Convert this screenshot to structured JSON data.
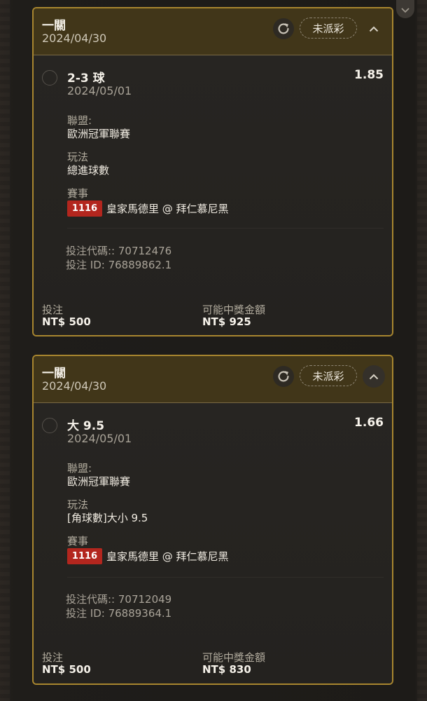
{
  "cards": [
    {
      "header": {
        "title": "一關",
        "date": "2024/04/30",
        "status_label": "未派彩"
      },
      "bet": {
        "selection": "2-3 球",
        "odds": "1.85",
        "date": "2024/05/01",
        "league_label": "聯盟:",
        "league_value": "歐洲冠軍聯賽",
        "play_label": "玩法",
        "play_value": "總進球數",
        "match_label": "賽事",
        "match_code": "1116",
        "match_name": "皇家馬德里 @ 拜仁慕尼黑",
        "bet_code": "投注代碼:: 70712476",
        "bet_id": "投注 ID: 76889862.1"
      },
      "footer": {
        "stake_label": "投注",
        "stake_value": "NT$ 500",
        "payout_label": "可能中獎金額",
        "payout_value": "NT$ 925"
      }
    },
    {
      "header": {
        "title": "一關",
        "date": "2024/04/30",
        "status_label": "未派彩"
      },
      "bet": {
        "selection": "大 9.5",
        "odds": "1.66",
        "date": "2024/05/01",
        "league_label": "聯盟:",
        "league_value": "歐洲冠軍聯賽",
        "play_label": "玩法",
        "play_value": "[角球數]大小 9.5",
        "match_label": "賽事",
        "match_code": "1116",
        "match_name": "皇家馬德里 @ 拜仁慕尼黑",
        "bet_code": "投注代碼:: 70712049",
        "bet_id": "投注 ID: 76889364.1"
      },
      "footer": {
        "stake_label": "投注",
        "stake_value": "NT$ 500",
        "payout_label": "可能中獎金額",
        "payout_value": "NT$ 830"
      }
    }
  ],
  "colors": {
    "card_border": "#a8862f",
    "header_bg": "#413619",
    "match_code_bg": "#b3261e"
  },
  "icons": [
    "refresh-icon",
    "chevron-up-icon",
    "chevron-down-icon"
  ]
}
